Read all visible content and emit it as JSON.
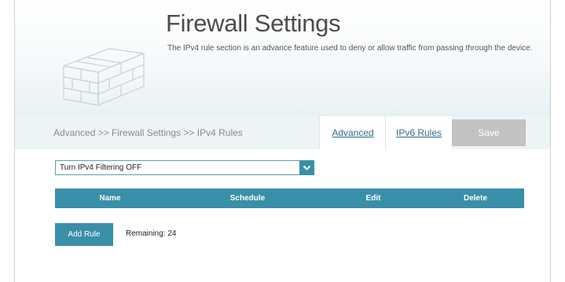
{
  "header": {
    "title": "Firewall Settings",
    "description": "The IPv4 rule section is an advance feature used to deny or allow traffic from passing through the device.",
    "icon": "brick-wall-icon"
  },
  "nav": {
    "breadcrumb": "Advanced >> Firewall Settings >> IPv4 Rules",
    "advanced_label": "Advanced",
    "ipv6_label": "IPv6 Rules",
    "save_label": "Save"
  },
  "filter": {
    "selected": "Turn IPv4 Filtering OFF"
  },
  "table": {
    "columns": [
      "Name",
      "Schedule",
      "Edit",
      "Delete"
    ],
    "rows": []
  },
  "actions": {
    "add_rule_label": "Add Rule",
    "remaining_text": "Remaining: 24"
  },
  "colors": {
    "accent": "#3a8fa8",
    "save_disabled": "#c2c2c2",
    "link": "#2f6f8f"
  }
}
